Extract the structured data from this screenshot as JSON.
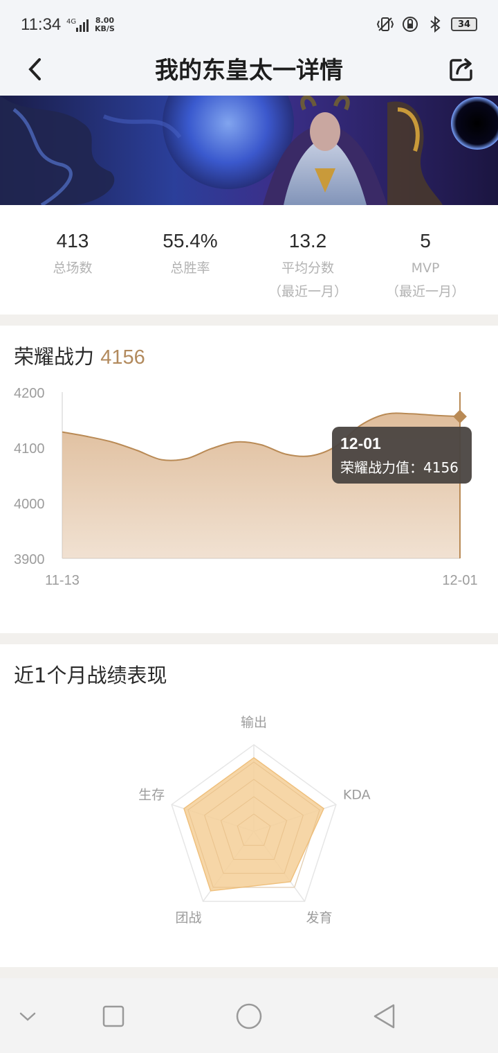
{
  "status_bar": {
    "time": "11:34",
    "network": "4G",
    "speed_value": "8.00",
    "speed_unit": "KB/S",
    "battery": "34"
  },
  "header": {
    "title": "我的东皇太一详情"
  },
  "stats": [
    {
      "value": "413",
      "label": "总场数",
      "sublabel": ""
    },
    {
      "value": "55.4%",
      "label": "总胜率",
      "sublabel": ""
    },
    {
      "value": "13.2",
      "label": "平均分数",
      "sublabel": "（最近一月）"
    },
    {
      "value": "5",
      "label": "MVP",
      "sublabel": "（最近一月）"
    }
  ],
  "power_section": {
    "title": "荣耀战力",
    "value": "4156",
    "tooltip_date": "12-01",
    "tooltip_label": "荣耀战力值：4156"
  },
  "chart_data": {
    "type": "area",
    "x_labels": [
      "11-13",
      "12-01"
    ],
    "y_ticks": [
      4200,
      4100,
      4000,
      3900
    ],
    "ylim": [
      3900,
      4200
    ],
    "values": [
      4128,
      4120,
      4110,
      4095,
      4078,
      4080,
      4098,
      4110,
      4105,
      4088,
      4085,
      4102,
      4140,
      4160,
      4161,
      4158,
      4156
    ],
    "highlight": {
      "date": "12-01",
      "value": 4156
    },
    "line_color": "#b98a55",
    "fill_color": "#dfbd9b"
  },
  "radar_section": {
    "title": "近1个月战绩表现",
    "axes": [
      "输出",
      "KDA",
      "发育",
      "团战",
      "生存"
    ],
    "values": [
      0.85,
      0.85,
      0.72,
      0.85,
      0.85
    ],
    "fill_color": "#f5cf98"
  },
  "colors": {
    "accent": "#b28a5d",
    "tooltip_bg": "#4a4541"
  },
  "icons": {
    "back": "chevron-left-icon",
    "share": "share-icon",
    "nav_collapse": "chevron-down-icon",
    "nav_recents": "square-icon",
    "nav_home": "circle-icon",
    "nav_back": "triangle-back-icon"
  }
}
